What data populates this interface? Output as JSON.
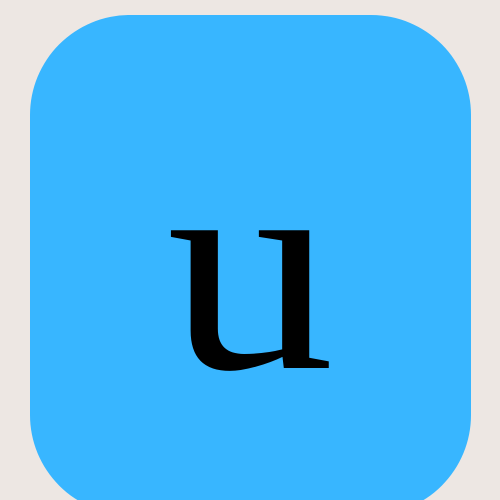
{
  "icon": {
    "letter": "u",
    "background_color": "#38b6ff",
    "letter_color": "#000000"
  },
  "page": {
    "background_color": "#ede7e3"
  }
}
